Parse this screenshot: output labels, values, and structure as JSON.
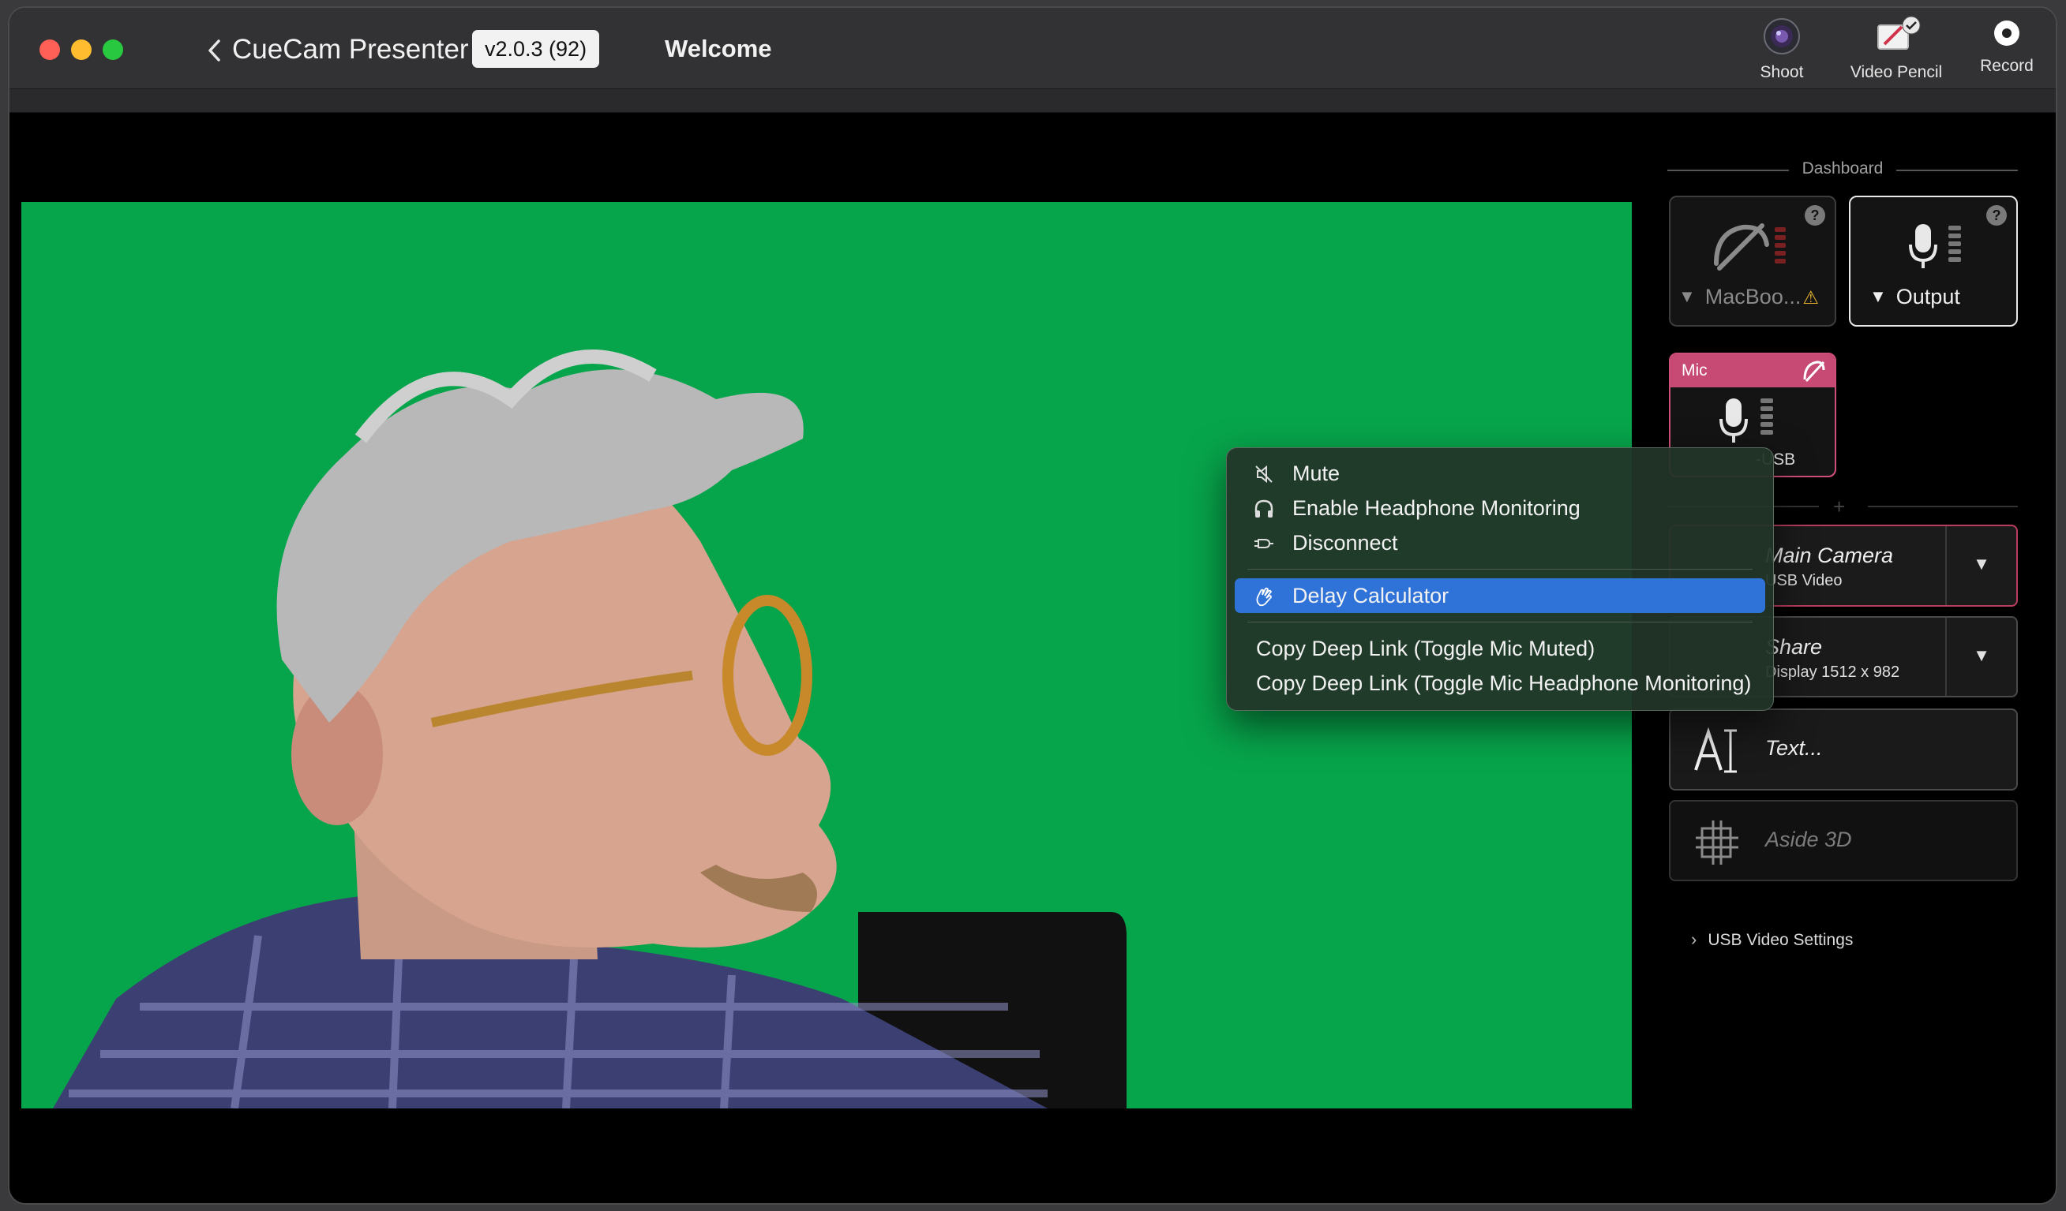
{
  "window": {
    "app_title": "CueCam Presenter",
    "version": "v2.0.3 (92)",
    "page_title": "Welcome"
  },
  "toolbar": {
    "shoot_label": "Shoot",
    "video_pencil_label": "Video Pencil",
    "record_label": "Record"
  },
  "dashboard": {
    "header": "Dashboard",
    "tiles": {
      "macbook_label": "MacBoo...",
      "output_label": "Output",
      "mic_header": "Mic",
      "mic_device_label": "-USB",
      "help": "?"
    },
    "sources": [
      {
        "name": "Main Camera",
        "sub": "USB Video"
      },
      {
        "name": "Share",
        "sub": "Display 1512 x 982"
      },
      {
        "name": "Text..."
      },
      {
        "name": "Aside 3D"
      }
    ],
    "usb_settings": "USB Video Settings"
  },
  "context_menu": {
    "items": [
      {
        "label": "Mute",
        "icon": "speaker-muted-icon"
      },
      {
        "label": "Enable Headphone Monitoring",
        "icon": "headphones-icon"
      },
      {
        "label": "Disconnect",
        "icon": "plug-icon"
      },
      {
        "label": "Delay Calculator",
        "icon": "clap-icon",
        "selected": true
      },
      {
        "label": "Copy Deep Link (Toggle Mic Muted)"
      },
      {
        "label": "Copy Deep Link (Toggle Mic Headphone Monitoring)"
      }
    ]
  },
  "colors": {
    "green_screen": "#07a54b",
    "mic_accent": "#c64a74",
    "menu_highlight": "#2f72d8"
  }
}
